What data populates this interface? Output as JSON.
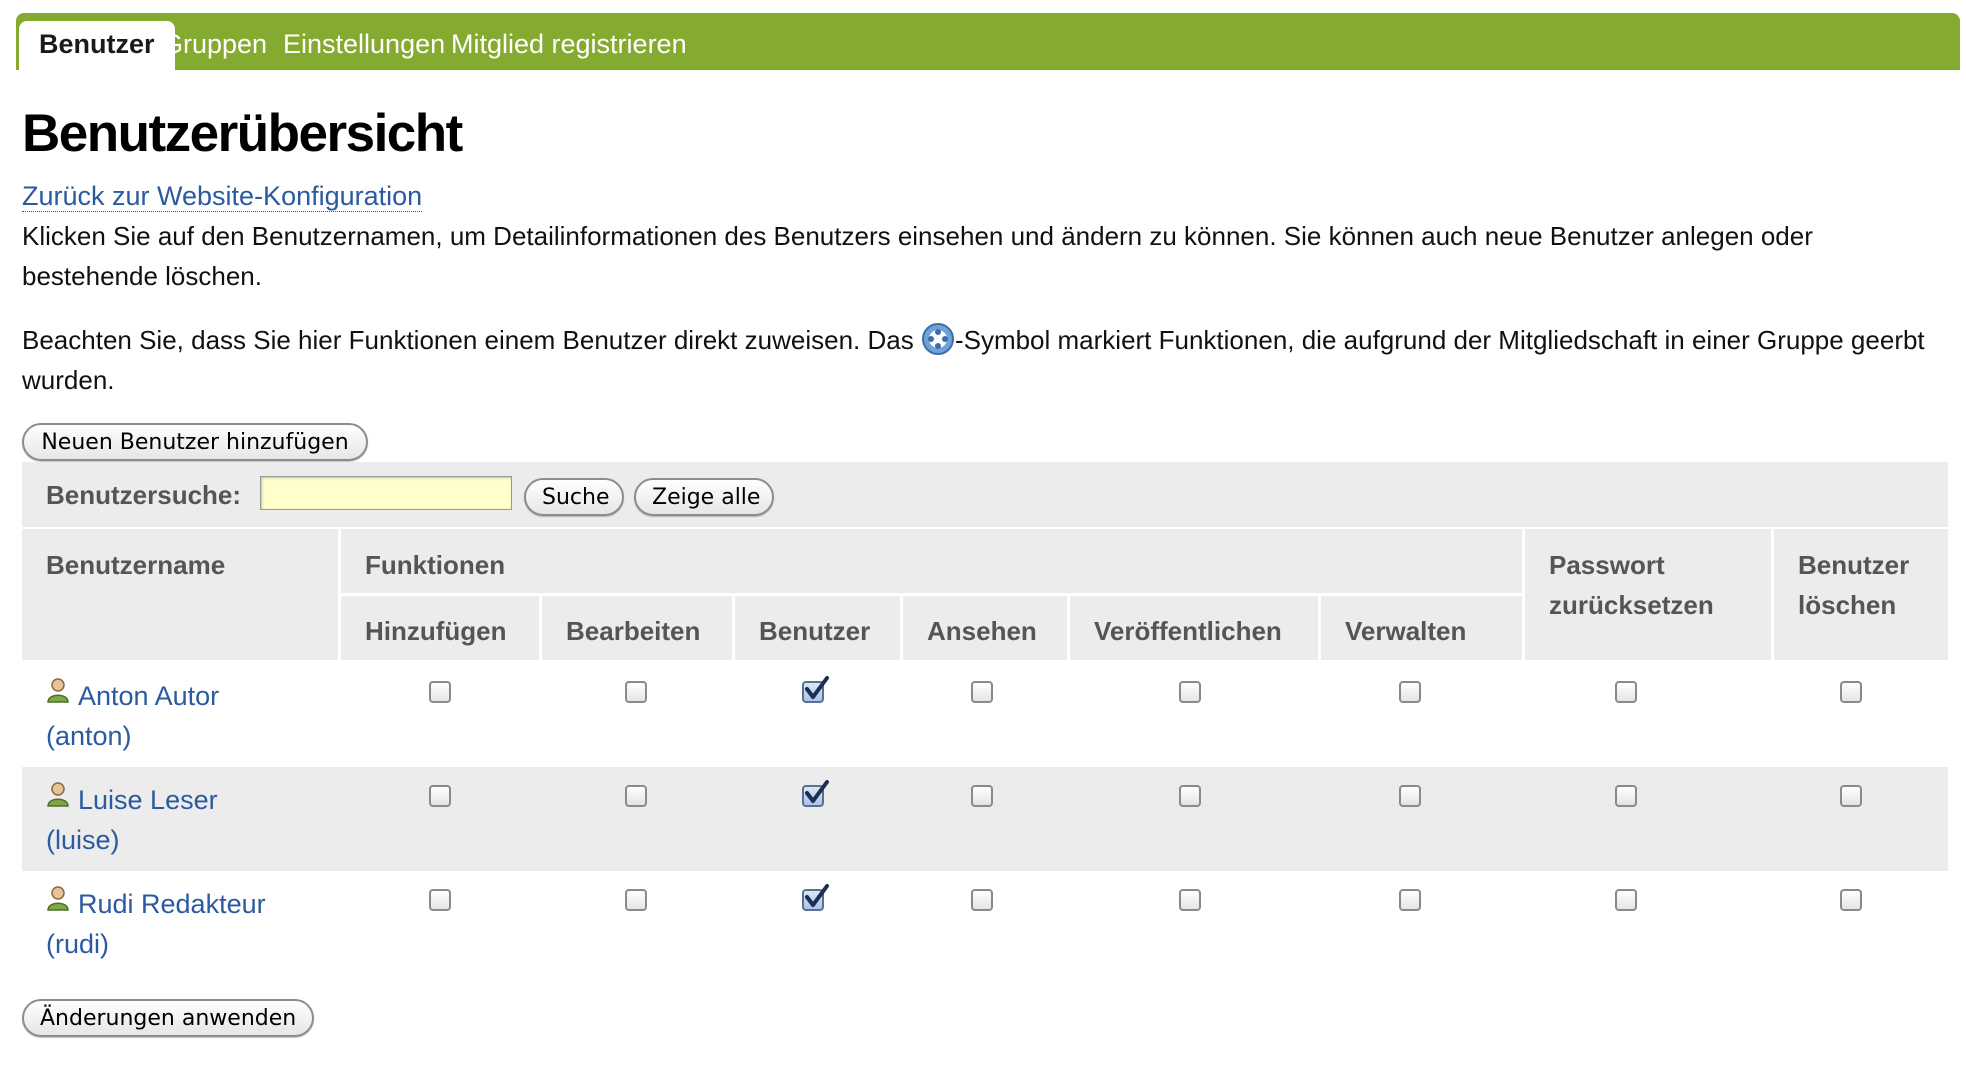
{
  "tabs": [
    {
      "label": "Benutzer",
      "active": true
    },
    {
      "label": "Gruppen",
      "active": false
    },
    {
      "label": "Einstellungen",
      "active": false
    },
    {
      "label": "Mitglied registrieren",
      "active": false
    }
  ],
  "page_title": "Benutzerübersicht",
  "back_link": "Zurück zur Website-Konfiguration",
  "intro_text": "Klicken Sie auf den Benutzernamen, um Detailinformationen des Benutzers einsehen und ändern zu können. Sie können auch neue Benutzer anlegen oder bestehende löschen.",
  "note": {
    "before": "Beachten Sie, dass Sie hier Funktionen einem Benutzer direkt zuweisen. Das ",
    "icon": "inherited-role-icon",
    "after": "-Symbol markiert Funktionen, die aufgrund der Mitgliedschaft in einer Gruppe geerbt wurden."
  },
  "add_user_button": "Neuen Benutzer hinzufügen",
  "search": {
    "label": "Benutzersuche:",
    "value": "",
    "search_button": "Suche",
    "show_all_button": "Zeige alle"
  },
  "table": {
    "col_username": "Benutzername",
    "col_roles": "Funktionen",
    "roles": [
      "Hinzufügen",
      "Bearbeiten",
      "Benutzer",
      "Ansehen",
      "Veröffentlichen",
      "Verwalten"
    ],
    "col_reset_password": "Passwort zurücksetzen",
    "col_delete_user": "Benutzer löschen",
    "rows": [
      {
        "name": "Anton Autor",
        "login": "(anton)",
        "roles": [
          false,
          false,
          true,
          false,
          false,
          false
        ],
        "reset_password": false,
        "delete": false
      },
      {
        "name": "Luise Leser",
        "login": "(luise)",
        "roles": [
          false,
          false,
          true,
          false,
          false,
          false
        ],
        "reset_password": false,
        "delete": false
      },
      {
        "name": "Rudi Redakteur",
        "login": "(rudi)",
        "roles": [
          false,
          false,
          true,
          false,
          false,
          false
        ],
        "reset_password": false,
        "delete": false
      }
    ]
  },
  "apply_button": "Änderungen anwenden",
  "colors": {
    "tabbar": "#84aa30",
    "link": "#2b5aa0",
    "header_bg": "#ececec",
    "search_input_bg": "#ffffcc"
  }
}
